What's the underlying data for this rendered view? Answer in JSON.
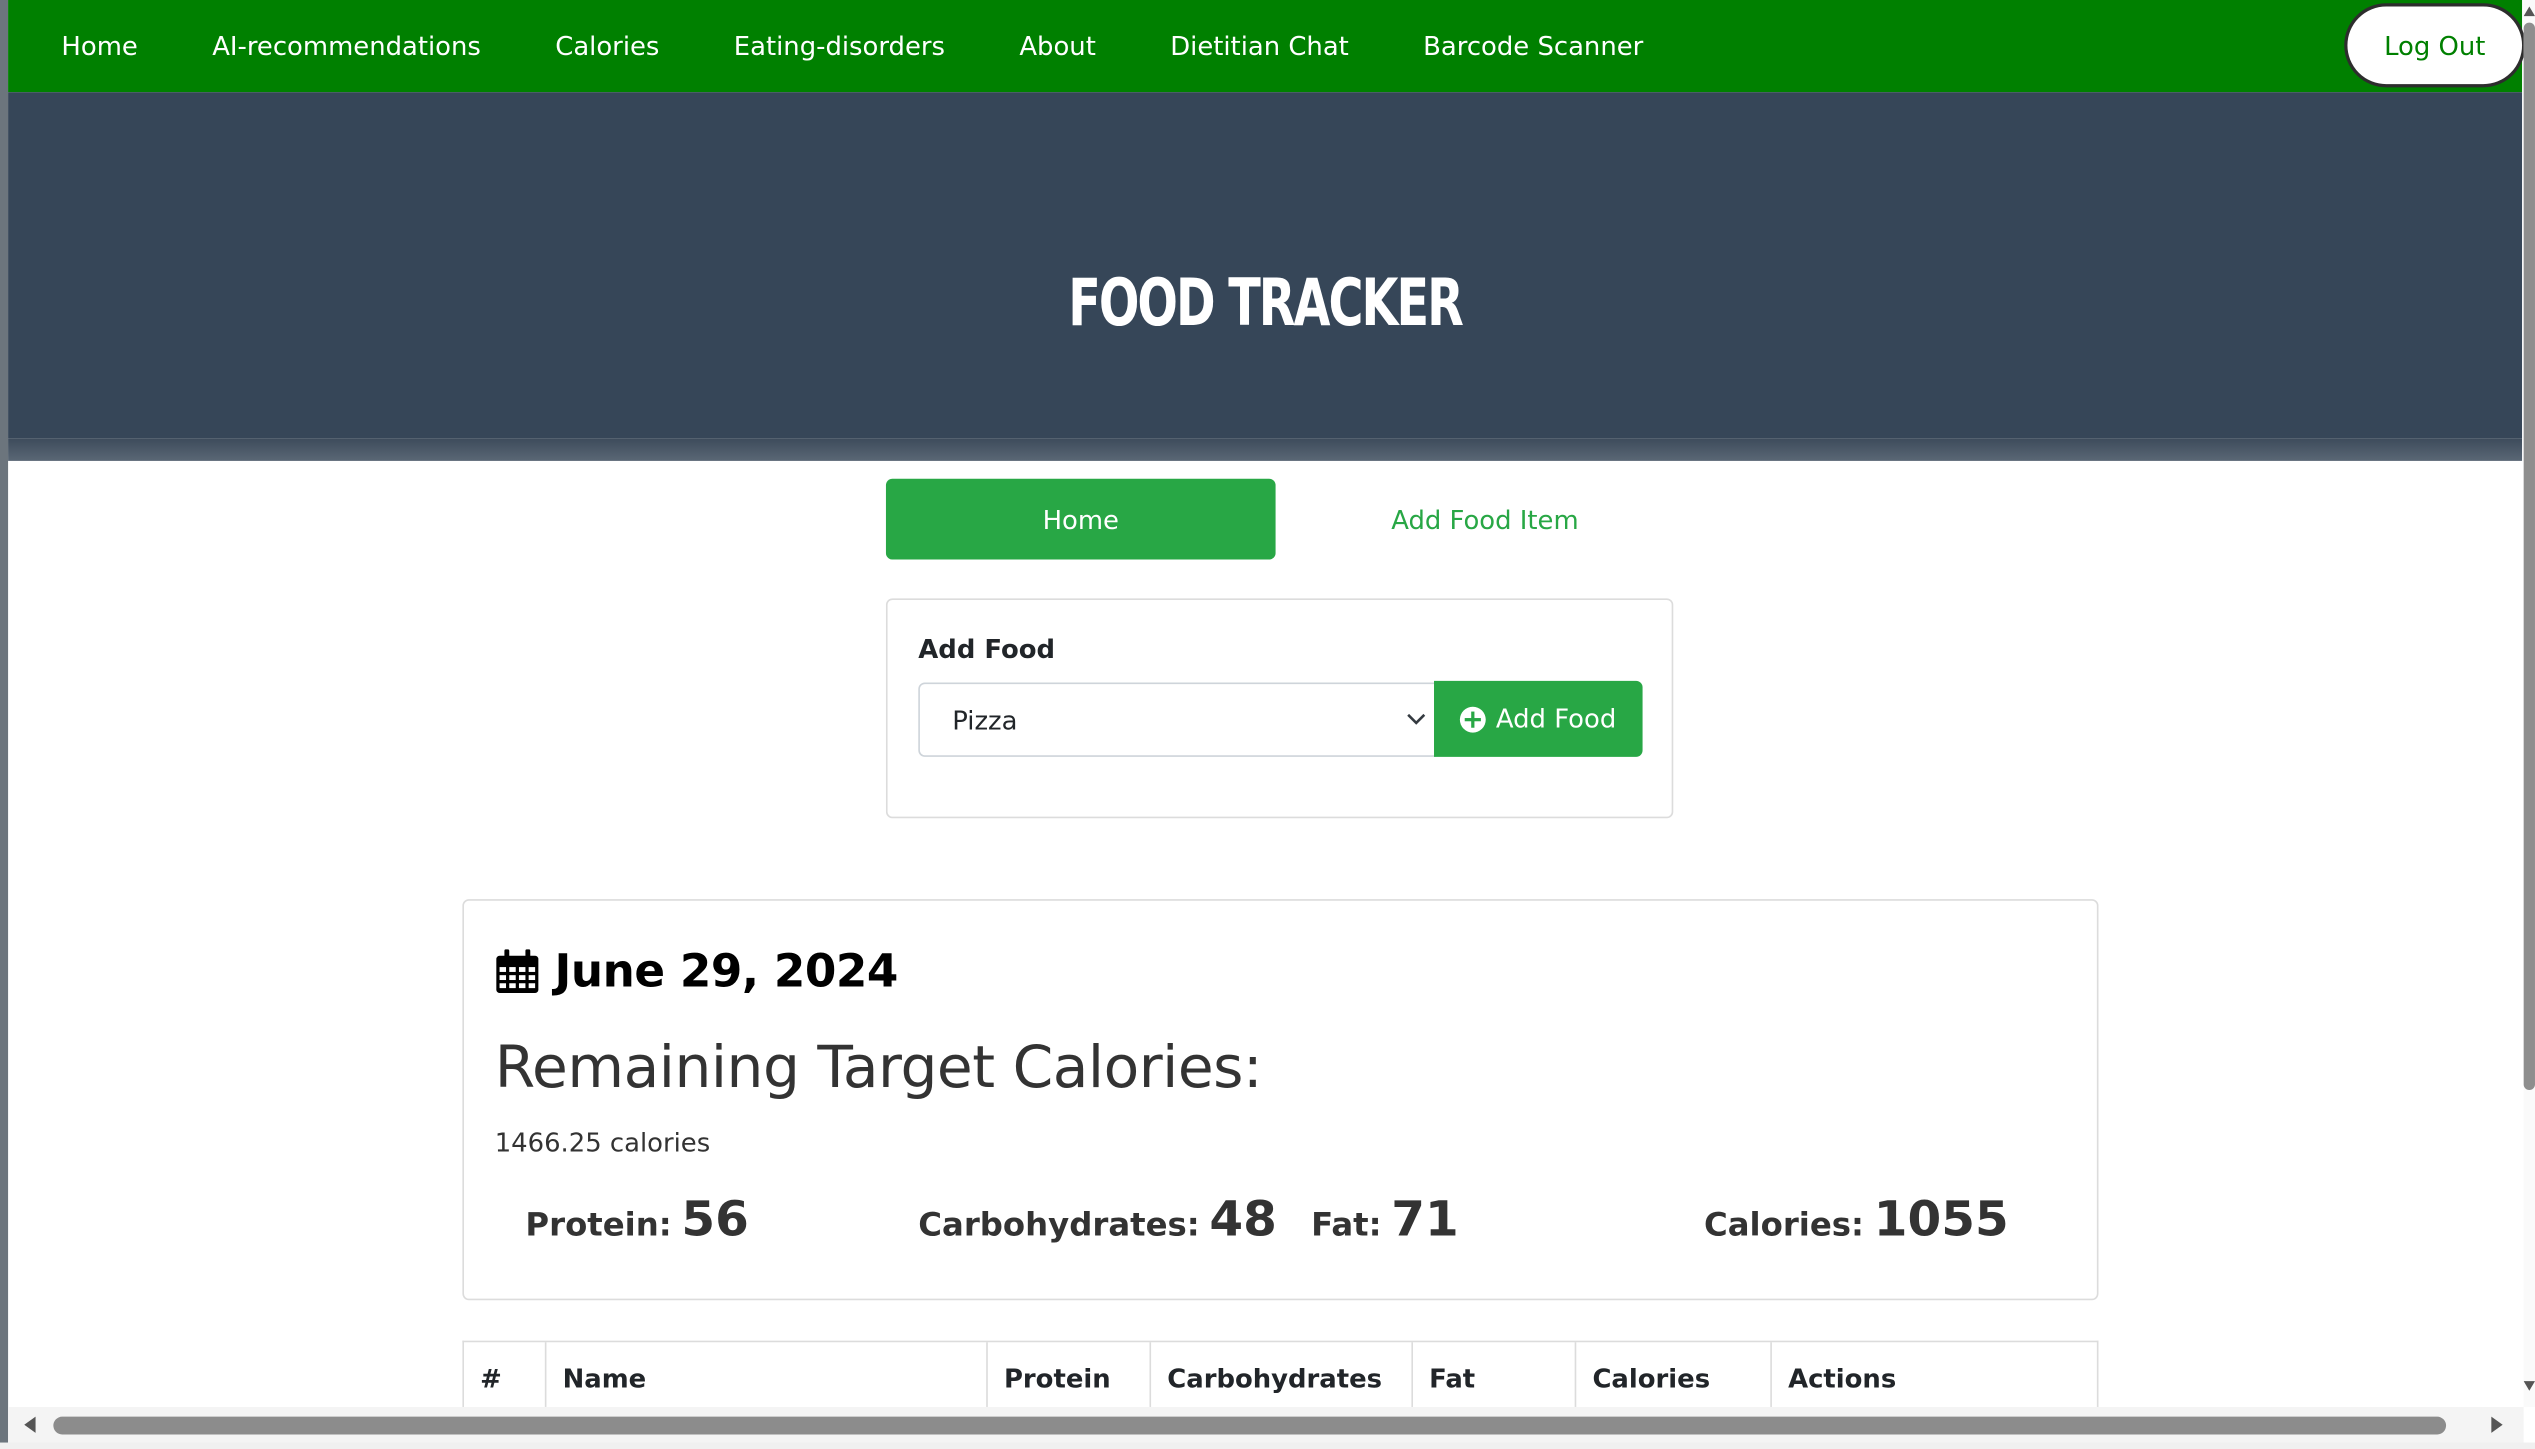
{
  "nav": {
    "items": [
      {
        "label": "Home"
      },
      {
        "label": "AI-recommendations"
      },
      {
        "label": "Calories"
      },
      {
        "label": "Eating-disorders"
      },
      {
        "label": "About"
      },
      {
        "label": "Dietitian Chat"
      },
      {
        "label": "Barcode Scanner"
      }
    ],
    "logout_label": "Log Out"
  },
  "hero": {
    "title": "FOOD TRACKER"
  },
  "tabs": {
    "home_label": "Home",
    "add_food_item_label": "Add Food Item"
  },
  "add_food": {
    "label": "Add Food",
    "selected_food": "Pizza",
    "button_label": "Add Food"
  },
  "summary": {
    "date": "June 29, 2024",
    "remaining_title": "Remaining Target Calories:",
    "remaining_value": "1466.25 calories",
    "macros": {
      "protein_label": "Protein:",
      "protein_value": "56",
      "carbs_label": "Carbohydrates:",
      "carbs_value": "48",
      "fat_label": "Fat:",
      "fat_value": "71",
      "calories_label": "Calories:",
      "calories_value": "1055"
    }
  },
  "table": {
    "headers": [
      "#",
      "Name",
      "Protein",
      "Carbohydrates",
      "Fat",
      "Calories",
      "Actions"
    ]
  },
  "colors": {
    "nav_green": "#008000",
    "accent_green": "#28a745",
    "hero_bg": "#364658"
  },
  "icons": {
    "calendar": "calendar-icon",
    "plus": "plus-circle-icon",
    "select_chevron": "chevron-down-icon"
  }
}
